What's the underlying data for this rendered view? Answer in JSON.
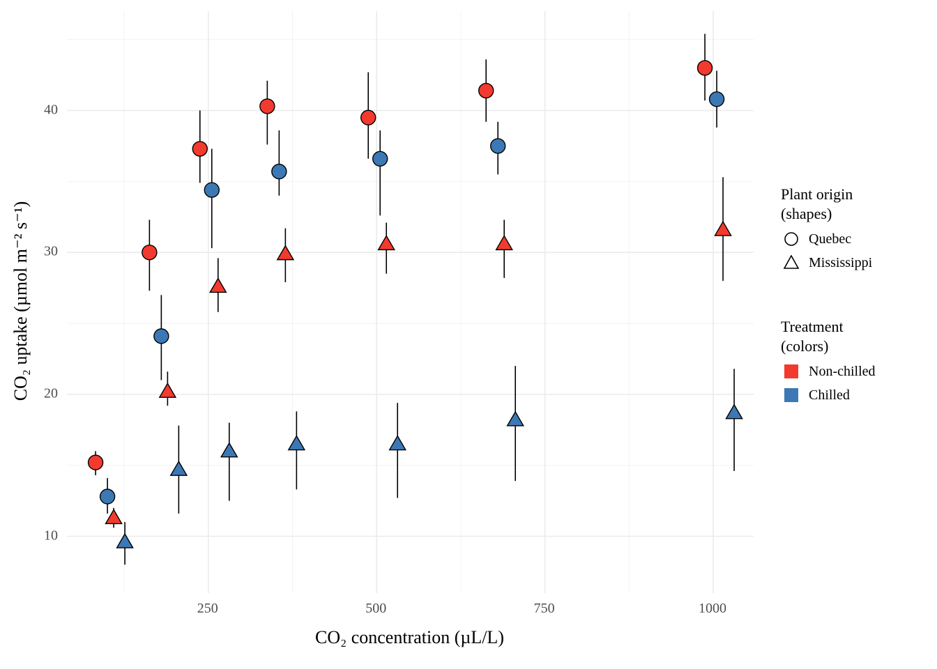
{
  "chart_data": {
    "type": "scatter",
    "title": "",
    "xlabel": "CO₂ concentration (µL/L)",
    "ylabel": "CO₂ uptake (µmol m⁻² s⁻¹)",
    "xlim": [
      40,
      1060
    ],
    "ylim": [
      6,
      47
    ],
    "x_ticks": [
      250,
      500,
      750,
      1000
    ],
    "y_ticks": [
      10,
      20,
      30,
      40
    ],
    "x_minor": [
      125,
      375,
      625,
      875
    ],
    "y_minor": [
      15,
      25,
      35,
      45
    ],
    "colors": {
      "Non-chilled": "#F23A2E",
      "Chilled": "#3C78B4"
    },
    "shapes": {
      "Quebec": "circle",
      "Mississippi": "triangle"
    },
    "legend_shape": {
      "title": "Plant origin\n(shapes)",
      "items": [
        "Quebec",
        "Mississippi"
      ]
    },
    "legend_color": {
      "title": "Treatment\n(colors)",
      "items": [
        "Non-chilled",
        "Chilled"
      ]
    },
    "series": [
      {
        "name": "Quebec Non-chilled",
        "shape": "circle",
        "color": "#F23A2E",
        "dx": -12,
        "points": [
          {
            "x": 95,
            "y": 15.2,
            "elo": 14.3,
            "ehi": 16.0
          },
          {
            "x": 175,
            "y": 30.0,
            "elo": 27.3,
            "ehi": 32.3
          },
          {
            "x": 250,
            "y": 37.3,
            "elo": 34.9,
            "ehi": 40.0
          },
          {
            "x": 350,
            "y": 40.3,
            "elo": 37.6,
            "ehi": 42.1
          },
          {
            "x": 500,
            "y": 39.5,
            "elo": 36.6,
            "ehi": 42.7
          },
          {
            "x": 675,
            "y": 41.4,
            "elo": 39.2,
            "ehi": 43.6
          },
          {
            "x": 1000,
            "y": 43.0,
            "elo": 40.7,
            "ehi": 45.4
          }
        ]
      },
      {
        "name": "Quebec Chilled",
        "shape": "circle",
        "color": "#3C78B4",
        "dx": 5,
        "points": [
          {
            "x": 95,
            "y": 12.8,
            "elo": 11.6,
            "ehi": 14.1
          },
          {
            "x": 175,
            "y": 24.1,
            "elo": 21.0,
            "ehi": 27.0
          },
          {
            "x": 250,
            "y": 34.4,
            "elo": 30.3,
            "ehi": 37.3
          },
          {
            "x": 350,
            "y": 35.7,
            "elo": 34.0,
            "ehi": 38.6
          },
          {
            "x": 500,
            "y": 36.6,
            "elo": 32.6,
            "ehi": 38.6
          },
          {
            "x": 675,
            "y": 37.5,
            "elo": 35.5,
            "ehi": 39.2
          },
          {
            "x": 1000,
            "y": 40.8,
            "elo": 38.8,
            "ehi": 42.8
          }
        ]
      },
      {
        "name": "Mississippi Non-chilled",
        "shape": "triangle",
        "color": "#F23A2E",
        "dx": 14,
        "points": [
          {
            "x": 95,
            "y": 11.3,
            "elo": 10.6,
            "ehi": 12.0
          },
          {
            "x": 175,
            "y": 20.2,
            "elo": 19.2,
            "ehi": 21.6
          },
          {
            "x": 250,
            "y": 27.6,
            "elo": 25.8,
            "ehi": 29.6
          },
          {
            "x": 350,
            "y": 29.9,
            "elo": 27.9,
            "ehi": 31.7
          },
          {
            "x": 500,
            "y": 30.6,
            "elo": 28.5,
            "ehi": 32.1
          },
          {
            "x": 675,
            "y": 30.6,
            "elo": 28.2,
            "ehi": 32.3
          },
          {
            "x": 1000,
            "y": 31.6,
            "elo": 28.0,
            "ehi": 35.3
          }
        ]
      },
      {
        "name": "Mississippi Chilled",
        "shape": "triangle",
        "color": "#3C78B4",
        "dx": 30,
        "points": [
          {
            "x": 95,
            "y": 9.6,
            "elo": 8.0,
            "ehi": 11.0
          },
          {
            "x": 175,
            "y": 14.7,
            "elo": 11.6,
            "ehi": 17.8
          },
          {
            "x": 250,
            "y": 16.0,
            "elo": 12.5,
            "ehi": 18.0
          },
          {
            "x": 350,
            "y": 16.5,
            "elo": 13.3,
            "ehi": 18.8
          },
          {
            "x": 500,
            "y": 16.5,
            "elo": 12.7,
            "ehi": 19.4
          },
          {
            "x": 675,
            "y": 18.2,
            "elo": 13.9,
            "ehi": 22.0
          },
          {
            "x": 1000,
            "y": 18.7,
            "elo": 14.6,
            "ehi": 21.8
          }
        ]
      }
    ]
  },
  "labels": {
    "x_ticks": {
      "250": "250",
      "500": "500",
      "750": "750",
      "1000": "1000"
    },
    "y_ticks": {
      "10": "10",
      "20": "20",
      "30": "30",
      "40": "40"
    }
  }
}
